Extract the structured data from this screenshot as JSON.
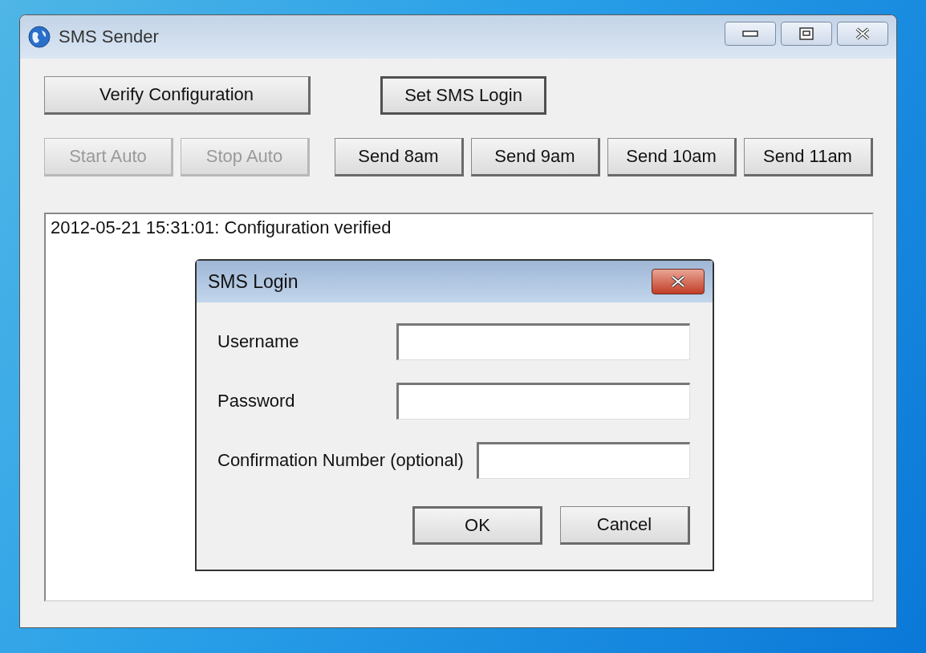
{
  "window": {
    "title": "SMS Sender"
  },
  "button_rows": [
    [
      {
        "label": "Verify Configuration",
        "disabled": false,
        "focused": false
      },
      {
        "label": "Set SMS Login",
        "disabled": false,
        "focused": true
      }
    ],
    [
      {
        "label": "Start Auto",
        "disabled": true,
        "focused": false
      },
      {
        "label": "Stop Auto",
        "disabled": true,
        "focused": false
      },
      {
        "label": "Send 8am",
        "disabled": false,
        "focused": false
      },
      {
        "label": "Send 9am",
        "disabled": false,
        "focused": false
      },
      {
        "label": "Send 10am",
        "disabled": false,
        "focused": false
      },
      {
        "label": "Send 11am",
        "disabled": false,
        "focused": false
      }
    ]
  ],
  "log": {
    "lines": [
      "2012-05-21 15:31:01: Configuration verified"
    ]
  },
  "dialog": {
    "title": "SMS Login",
    "fields": [
      {
        "label": "Username"
      },
      {
        "label": "Password"
      },
      {
        "label": "Confirmation Number (optional)"
      }
    ],
    "buttons": [
      {
        "label": "OK",
        "default": true
      },
      {
        "label": "Cancel",
        "default": false
      }
    ]
  }
}
